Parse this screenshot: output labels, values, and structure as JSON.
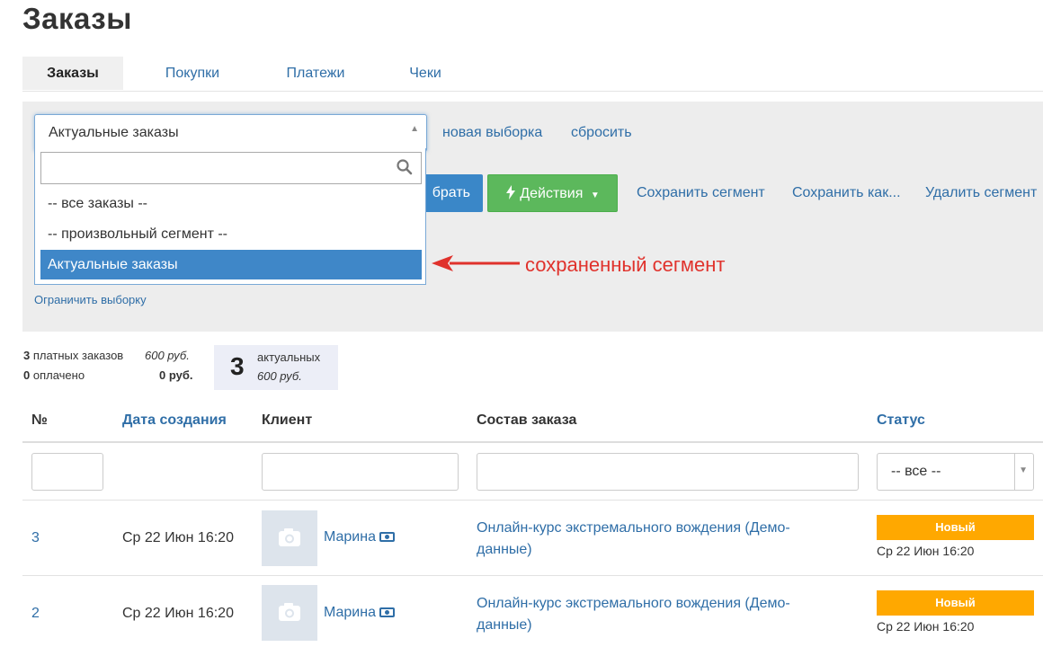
{
  "page": {
    "title": "Заказы"
  },
  "tabs": [
    {
      "label": "Заказы",
      "active": true
    },
    {
      "label": "Покупки"
    },
    {
      "label": "Платежи"
    },
    {
      "label": "Чеки"
    }
  ],
  "filter": {
    "segment_value": "Актуальные заказы",
    "new_selection": "новая выборка",
    "reset": "сбросить",
    "apply_button": "брать",
    "actions_button": "Действия",
    "save_segment": "Сохранить сегмент",
    "save_as": "Сохранить как...",
    "delete_segment": "Удалить сегмент",
    "limit_selection": "Ограничить выборку"
  },
  "dropdown": {
    "search_value": "",
    "options": [
      {
        "label": "-- все заказы --"
      },
      {
        "label": "-- произвольный сегмент --"
      },
      {
        "label": "Актуальные заказы",
        "selected": true
      }
    ]
  },
  "annotation": {
    "text": "сохраненный сегмент",
    "color": "#e0322c"
  },
  "stats": {
    "paid_count": "3",
    "paid_label": "платных заказов",
    "paid_sum": "600 руб.",
    "payed_count": "0",
    "payed_label": "оплачено",
    "payed_sum": "0 руб.",
    "actual_count": "3",
    "actual_label": "актуальных",
    "actual_sum": "600 руб."
  },
  "table": {
    "headers": {
      "number": "№",
      "created": "Дата создания",
      "client": "Клиент",
      "content": "Состав заказа",
      "status": "Статус"
    },
    "status_filter": "-- все --",
    "rows": [
      {
        "number": "3",
        "date": "Ср 22 Июн 16:20",
        "client": "Марина",
        "content": "Онлайн-курс экстремального вождения (Демо-данные)",
        "status": "Новый",
        "status_date": "Ср 22 Июн 16:20"
      },
      {
        "number": "2",
        "date": "Ср 22 Июн 16:20",
        "client": "Марина",
        "content": "Онлайн-курс экстремального вождения (Демо-данные)",
        "status": "Новый",
        "status_date": "Ср 22 Июн 16:20"
      }
    ]
  },
  "colors": {
    "link": "#2f6ea7",
    "primary": "#3a87c8",
    "success": "#5cb85c",
    "status_new": "#ffa800",
    "selected_option": "#3f87c8"
  },
  "icons": [
    "search-icon",
    "chevron-down-icon",
    "bolt-icon",
    "caret-down-icon",
    "camera-icon",
    "money-icon",
    "arrow-left-icon"
  ]
}
